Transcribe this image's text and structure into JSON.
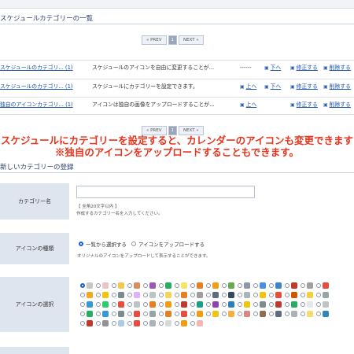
{
  "list_section": {
    "title": "スケジュールカテゴリーの一覧"
  },
  "pager": {
    "prev": "« PREV",
    "page": "1",
    "next": "NEXT »"
  },
  "rows": [
    {
      "name": "スケジュールのカテゴリ... (1)",
      "desc": "スケジュールのアイコンを自由に変更することが...",
      "dash": "------",
      "up": "",
      "down": "下へ",
      "edit": "修正する",
      "delete": "削除する"
    },
    {
      "name": "スケジュールのカテゴリ... (1)",
      "desc": "スケジュールにカテゴリーを設定できます。",
      "dash": "",
      "up": "上へ",
      "down": "下へ",
      "edit": "修正する",
      "delete": "削除する"
    },
    {
      "name": "独自のアイコンカテゴリ... (1)",
      "desc": "アイコンは独自の画像をアップロードすることが...",
      "dash": "",
      "up": "上へ",
      "down": "",
      "edit": "修正する",
      "delete": "削除する"
    }
  ],
  "banner": {
    "line1": "スケジュールにカテゴリーを設定すると、カレンダーのアイコンも変更できます",
    "line2": "※独自のアイコンをアップロードすることもできます。"
  },
  "new_section": {
    "title": "新しいカテゴリーの登録"
  },
  "form": {
    "category_name_label": "カテゴリー名",
    "category_name_value": "",
    "category_name_hint1": "【 全角20文字以内 】",
    "category_name_hint2": "作成するカテゴリー名を入力してください。",
    "icon_type_label": "アイコンの種類",
    "icon_type_option1": "一覧から選択する",
    "icon_type_option2": "アイコンをアップロードする",
    "icon_type_hint": "オリジナルのアイコンをアップロードして表示することができます。",
    "icon_select_label": "アイコンの選択"
  },
  "icon_colors": [
    [
      "#c7c7c7",
      "#e8c6c6",
      "#f2c94c",
      "#d98c5f",
      "#9b59b6",
      "#27ae60",
      "#f5e663",
      "#e67e22",
      "#f39c12",
      "#6aa84f",
      "#8e9aab",
      "#4a90e2",
      "#3d85c6",
      "#c0392b",
      "#a0a0a0",
      "#e74c3c"
    ],
    [
      "#f5a623",
      "#f1c40f",
      "#7f8c8d",
      "#e0b0ff",
      "#bdc3c7",
      "#f7d358",
      "#e67e22",
      "#9e9e9e",
      "#5d6d7e",
      "#34495e",
      "#aab7b8",
      "#f1c40f",
      "#e74c3c",
      "#d35400",
      "#f4d03f",
      "#95a5a6"
    ],
    [
      "#3498db",
      "#2ecc71",
      "#e74c3c",
      "#bdc3c7",
      "#e67e22",
      "#f39c12",
      "#c0392b",
      "#16a085",
      "#8e44ad",
      "#2980b9",
      "#f1c40f",
      "#7f8c8d",
      "#c0392b",
      "#27ae60",
      "#e5e7e9",
      "#bdc3c7"
    ],
    [
      "#27ae60",
      "#3498db",
      "#7f8c8d",
      "#e74c3c",
      "#95a5a6",
      "#e67e22",
      "#e74c3c",
      "#f39c12",
      "#f1c40f",
      "#f5b041",
      "#d98880",
      "#8e6e4e",
      "#5d6d7e",
      "#abb2b9",
      "#f7dc6f",
      "#2e86c1"
    ],
    [
      "#c0392b",
      "#909497",
      "#a9cce3",
      "#e74c3c",
      "#abb2b9",
      "#d5dbdb",
      "#f39c12",
      "#f5b7b1"
    ]
  ]
}
